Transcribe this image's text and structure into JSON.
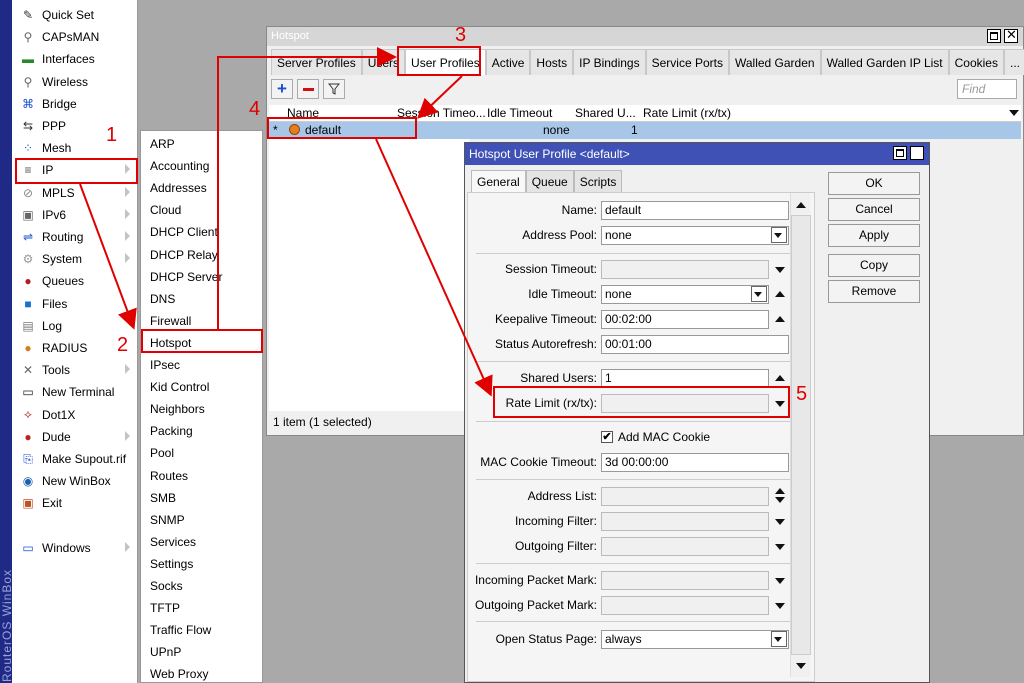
{
  "brand": "RouterOS WinBox",
  "main_menu": [
    {
      "label": "Quick Set",
      "icon": "wand-icon",
      "arrow": false
    },
    {
      "label": "CAPsMAN",
      "icon": "antenna-icon",
      "arrow": false
    },
    {
      "label": "Interfaces",
      "icon": "interfaces-icon",
      "arrow": false
    },
    {
      "label": "Wireless",
      "icon": "antenna-icon",
      "arrow": false
    },
    {
      "label": "Bridge",
      "icon": "bridge-icon",
      "arrow": false
    },
    {
      "label": "PPP",
      "icon": "ppp-icon",
      "arrow": false
    },
    {
      "label": "Mesh",
      "icon": "mesh-icon",
      "arrow": false
    },
    {
      "label": "IP",
      "icon": "ip-icon",
      "arrow": true
    },
    {
      "label": "MPLS",
      "icon": "mpls-icon",
      "arrow": true
    },
    {
      "label": "IPv6",
      "icon": "ipv6-icon",
      "arrow": true
    },
    {
      "label": "Routing",
      "icon": "routing-icon",
      "arrow": true
    },
    {
      "label": "System",
      "icon": "gear-icon",
      "arrow": true
    },
    {
      "label": "Queues",
      "icon": "queues-icon",
      "arrow": false
    },
    {
      "label": "Files",
      "icon": "folder-icon",
      "arrow": false
    },
    {
      "label": "Log",
      "icon": "log-icon",
      "arrow": false
    },
    {
      "label": "RADIUS",
      "icon": "users-icon",
      "arrow": false
    },
    {
      "label": "Tools",
      "icon": "tools-icon",
      "arrow": true
    },
    {
      "label": "New Terminal",
      "icon": "terminal-icon",
      "arrow": false
    },
    {
      "label": "Dot1X",
      "icon": "dot1x-icon",
      "arrow": false
    },
    {
      "label": "Dude",
      "icon": "dude-icon",
      "arrow": true
    },
    {
      "label": "Make Supout.rif",
      "icon": "supout-icon",
      "arrow": false
    },
    {
      "label": "New WinBox",
      "icon": "winbox-icon",
      "arrow": false
    },
    {
      "label": "Exit",
      "icon": "exit-icon",
      "arrow": false
    },
    {
      "label": "",
      "icon": "",
      "arrow": false
    },
    {
      "label": "Windows",
      "icon": "windows-icon",
      "arrow": true
    }
  ],
  "submenu": [
    "ARP",
    "Accounting",
    "Addresses",
    "Cloud",
    "DHCP Client",
    "DHCP Relay",
    "DHCP Server",
    "DNS",
    "Firewall",
    "Hotspot",
    "IPsec",
    "Kid Control",
    "Neighbors",
    "Packing",
    "Pool",
    "Routes",
    "SMB",
    "SNMP",
    "Services",
    "Settings",
    "Socks",
    "TFTP",
    "Traffic Flow",
    "UPnP",
    "Web Proxy"
  ],
  "hotspot": {
    "title": "Hotspot",
    "tabs": [
      "Server Profiles",
      "Users",
      "User Profiles",
      "Active",
      "Hosts",
      "IP Bindings",
      "Service Ports",
      "Walled Garden",
      "Walled Garden IP List",
      "Cookies",
      "..."
    ],
    "selected_tab": "User Profiles",
    "find_placeholder": "Find",
    "columns": [
      "Name",
      "Session Timeo...",
      "Idle Timeout",
      "Shared U...",
      "Rate Limit (rx/tx)"
    ],
    "rows": [
      {
        "marker": "*",
        "name": "default",
        "session": "",
        "idle": "none",
        "shared": "1",
        "rate": ""
      }
    ],
    "status": "1 item (1 selected)"
  },
  "dialog": {
    "title": "Hotspot User Profile <default>",
    "tabs": [
      "General",
      "Queue",
      "Scripts"
    ],
    "fields": {
      "name": {
        "label": "Name:",
        "value": "default"
      },
      "address_pool": {
        "label": "Address Pool:",
        "value": "none"
      },
      "session_timeout": {
        "label": "Session Timeout:",
        "value": ""
      },
      "idle_timeout": {
        "label": "Idle Timeout:",
        "value": "none"
      },
      "keepalive_timeout": {
        "label": "Keepalive Timeout:",
        "value": "00:02:00"
      },
      "status_autorefresh": {
        "label": "Status Autorefresh:",
        "value": "00:01:00"
      },
      "shared_users": {
        "label": "Shared Users:",
        "value": "1"
      },
      "rate_limit": {
        "label": "Rate Limit (rx/tx):",
        "value": ""
      },
      "add_mac_cookie": {
        "label": "Add MAC Cookie",
        "checked": true
      },
      "mac_cookie_timeout": {
        "label": "MAC Cookie Timeout:",
        "value": "3d 00:00:00"
      },
      "address_list": {
        "label": "Address List:",
        "value": ""
      },
      "incoming_filter": {
        "label": "Incoming Filter:",
        "value": ""
      },
      "outgoing_filter": {
        "label": "Outgoing Filter:",
        "value": ""
      },
      "incoming_packet_mark": {
        "label": "Incoming Packet Mark:",
        "value": ""
      },
      "outgoing_packet_mark": {
        "label": "Outgoing Packet Mark:",
        "value": ""
      },
      "open_status_page": {
        "label": "Open Status Page:",
        "value": "always"
      }
    },
    "buttons": [
      "OK",
      "Cancel",
      "Apply",
      "Copy",
      "Remove"
    ]
  },
  "annotations": [
    "1",
    "2",
    "3",
    "4",
    "5"
  ],
  "colors": {
    "annotation": "#e00000",
    "selection": "#a8c6e8",
    "dialog_title": "#3f51b5",
    "brand_bar": "#1f2a86"
  }
}
